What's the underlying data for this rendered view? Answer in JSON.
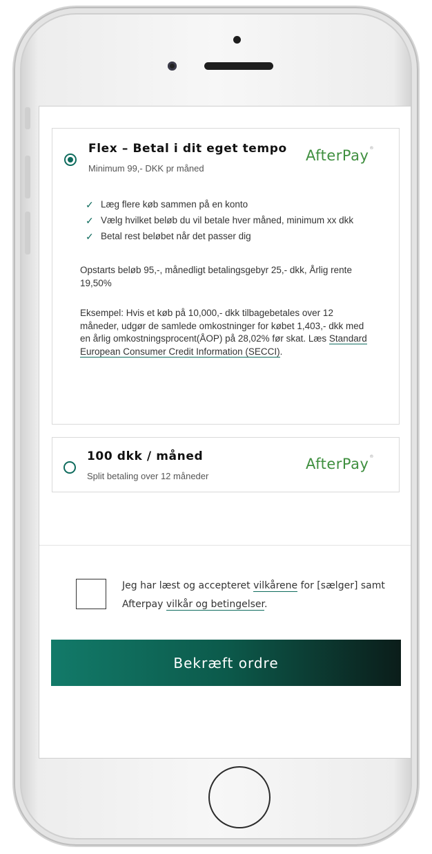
{
  "flex_option": {
    "title": "Flex – Betal i dit eget tempo",
    "subtitle": "Minimum 99,- DKK pr måned",
    "logo": "AfterPay",
    "benefits": [
      "Læg flere køb sammen på  en konto",
      "Vælg hvilket beløb du vil betale hver måned, minimum xx dkk",
      "Betal rest beløbet når det passer dig"
    ],
    "fees": "Opstarts beløb 95,-, månedligt betalingsgebyr 25,- dkk, Årlig rente 19,50%",
    "example_text": "Eksempel: Hvis et køb på 10,000,- dkk tilbagebetales over 12 måneder, udgør de samlede omkostninger for købet 1,403,- dkk med en årlig omkostningsprocent(ÅOP) på 28,02% før skat. Læs ",
    "example_link": "Standard European Consumer Credit Information (SECCI)",
    "example_end": ".",
    "selected": true
  },
  "monthly_option": {
    "title": "100 dkk / måned",
    "subtitle": "Split betaling over 12 måneder",
    "logo": "AfterPay",
    "selected": false
  },
  "terms": {
    "text_1": "Jeg har læst og accepteret ",
    "link_1": "vilkårene",
    "text_2": " for [sælger] samt Afterpay ",
    "link_2": "vilkår og betingelser",
    "text_3": "."
  },
  "confirm_button": "Bekræft ordre",
  "colors": {
    "accent": "#0e6b5d",
    "logo_green": "#3f8f3f",
    "button_dark": "#0b1d1a"
  },
  "icons": {
    "check": "checkmark-icon",
    "logo": "afterpay-logo"
  }
}
